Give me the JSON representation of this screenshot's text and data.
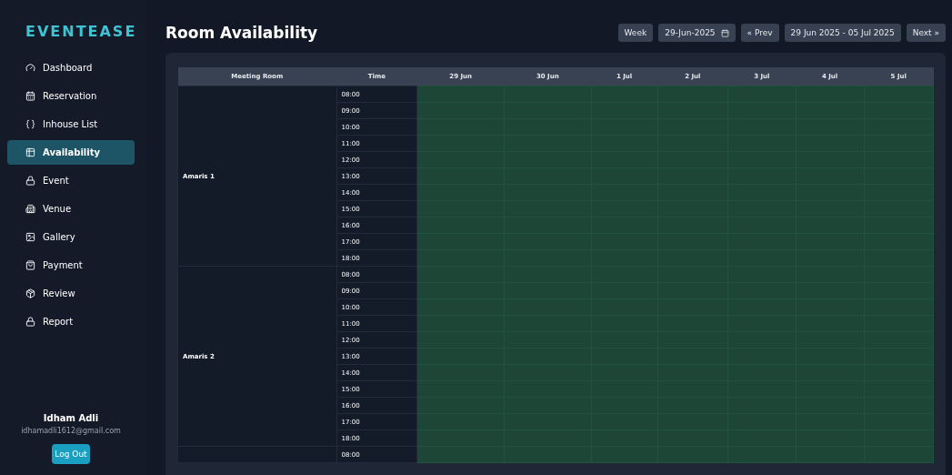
{
  "brand": "EVENTEASE",
  "sidebar": {
    "items": [
      {
        "label": "Dashboard",
        "selected": false
      },
      {
        "label": "Reservation",
        "selected": false
      },
      {
        "label": "Inhouse List",
        "selected": false
      },
      {
        "label": "Availability",
        "selected": true
      },
      {
        "label": "Event",
        "selected": false
      },
      {
        "label": "Venue",
        "selected": false
      },
      {
        "label": "Gallery",
        "selected": false
      },
      {
        "label": "Payment",
        "selected": false
      },
      {
        "label": "Review",
        "selected": false
      },
      {
        "label": "Report",
        "selected": false
      }
    ],
    "user": {
      "name": "Idham Adli",
      "email": "idhamadli1612@gmail.com"
    },
    "logout": "Log Out"
  },
  "page_title": "Room Availability",
  "toolbar": {
    "view": "Week",
    "date": "29-Jun-2025",
    "prev": "« Prev",
    "range": "29 Jun 2025 - 05 Jul 2025",
    "next": "Next »"
  },
  "table": {
    "columns": [
      "Meeting Room",
      "Time",
      "29 Jun",
      "30 Jun",
      "1 Jul",
      "2 Jul",
      "3 Jul",
      "4 Jul",
      "5 Jul"
    ],
    "rooms": [
      {
        "name": "Amaris 1",
        "times": [
          "08:00",
          "09:00",
          "10:00",
          "11:00",
          "12:00",
          "13:00",
          "14:00",
          "15:00",
          "16:00",
          "17:00",
          "18:00"
        ]
      },
      {
        "name": "Amaris 2",
        "times": [
          "08:00",
          "09:00",
          "10:00",
          "11:00",
          "12:00",
          "13:00",
          "14:00",
          "15:00",
          "16:00",
          "17:00",
          "18:00"
        ]
      },
      {
        "times": [
          "08:00"
        ]
      }
    ]
  }
}
